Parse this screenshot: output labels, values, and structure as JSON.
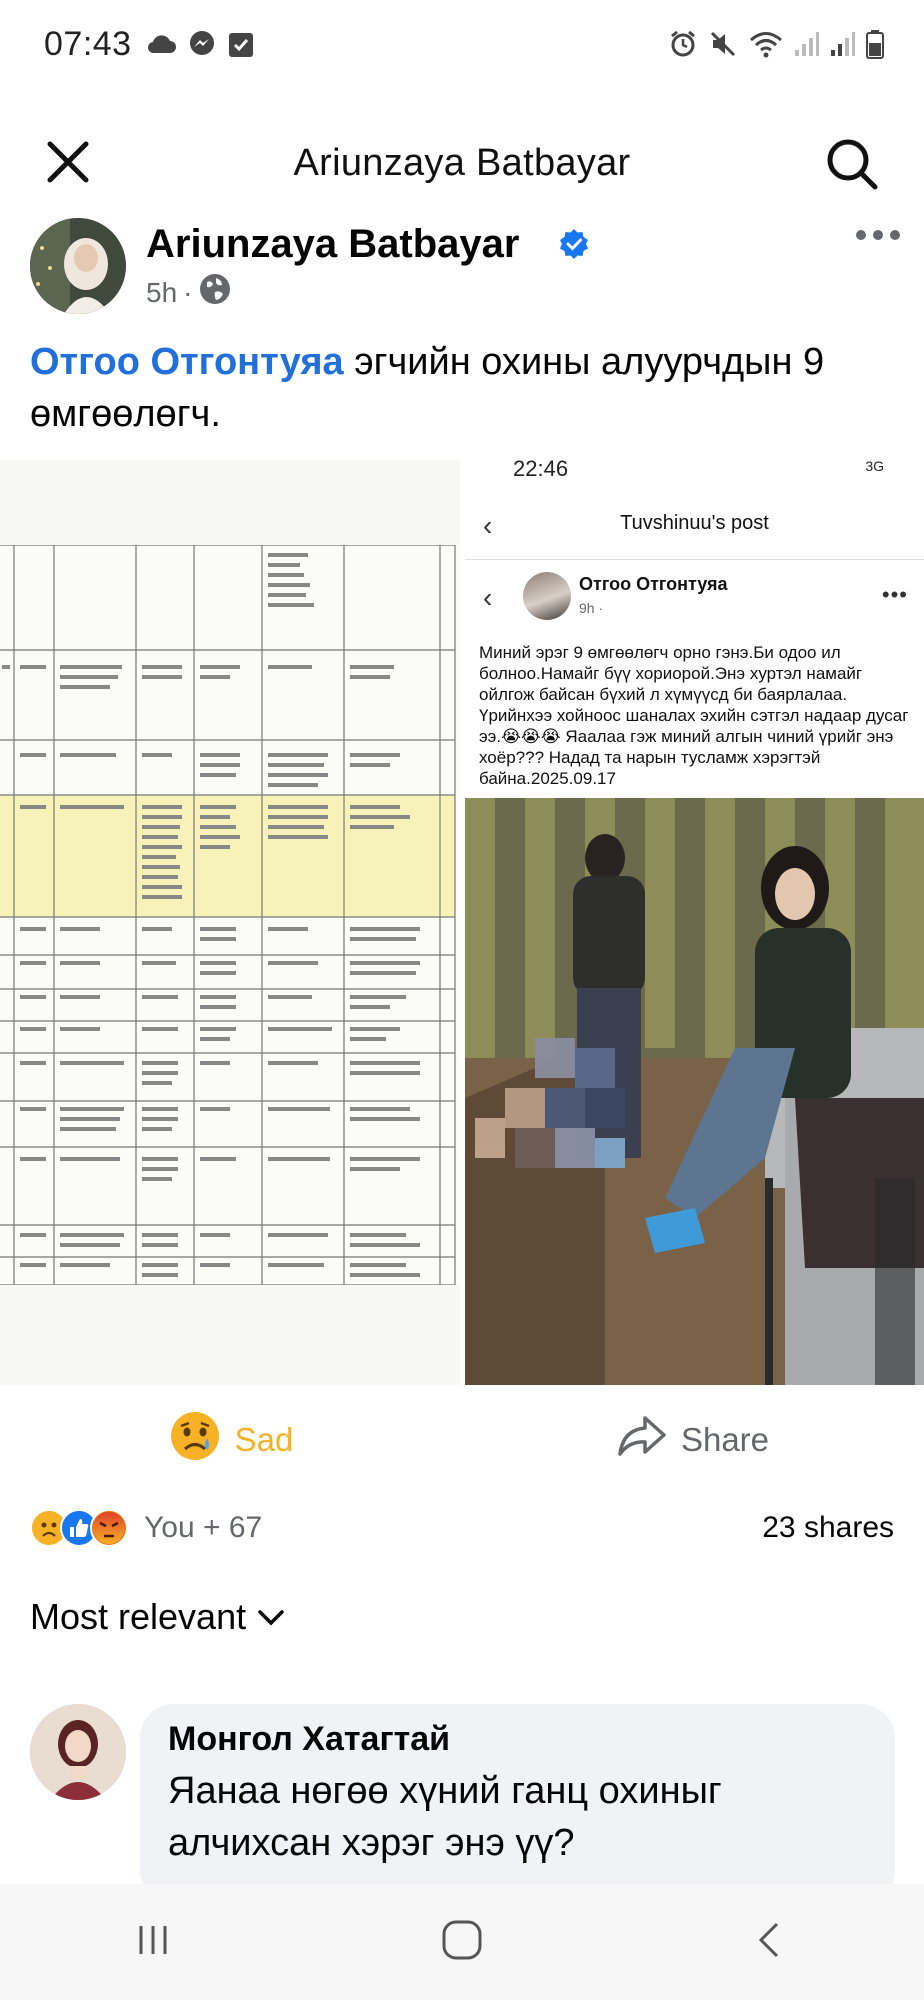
{
  "status_bar": {
    "time": "07:43",
    "left_icons": [
      "cloud-icon",
      "messenger-icon",
      "check-box-icon"
    ],
    "right_icons": [
      "alarm-icon",
      "mute-icon",
      "wifi-icon",
      "signal-icon",
      "signal-icon",
      "battery-icon"
    ]
  },
  "nav": {
    "title": "Ariunzaya Batbayar"
  },
  "post": {
    "author": "Ariunzaya Batbayar",
    "time": "5h",
    "separator": "·",
    "mention": "Отгоо Отгонтуяа",
    "text": " эгчийн охины алуурчдын 9 өмгөөлөгч."
  },
  "embedded_screenshot": {
    "status_time": "22:46",
    "status_right": "3G",
    "nav_title": "Tuvshinuu's post",
    "poster_name": "Отгоо Отгонтуяа",
    "poster_time": "9h ·",
    "post_text": "Миний эрэг 9 өмгөөлөгч орно гэнэ.Би одоо ил болноо.Намайг бүү хориорой.Энэ хуртэл намайг ойлгож байсан бүхий л хүмүүсд би баярлалаа. Үрийнхээ хойноос шаналах эхийн сэтгэл надаар дусаг ээ.😭😭😭 Яаалаа гэж миний алгын чиний үрийг энэ хоёр??? Надад та нарын тусламж хэрэгтэй байна.2025.09.17"
  },
  "actions": {
    "sad_label": "Sad",
    "share_label": "Share"
  },
  "reactions": {
    "summary": "You + 67",
    "shares": "23 shares"
  },
  "comments": {
    "sort_label": "Most relevant",
    "items": [
      {
        "author": "Монгол Хатагтай",
        "text": "Яанаа нөгөө хүний ганц охиныг алчихсан хэрэг энэ үү?"
      }
    ]
  },
  "colors": {
    "accent": "#216fdb",
    "sad": "#f7b125",
    "secondary_text": "#65676b",
    "bubble": "#f0f2f5",
    "verified": "#1877f2"
  }
}
